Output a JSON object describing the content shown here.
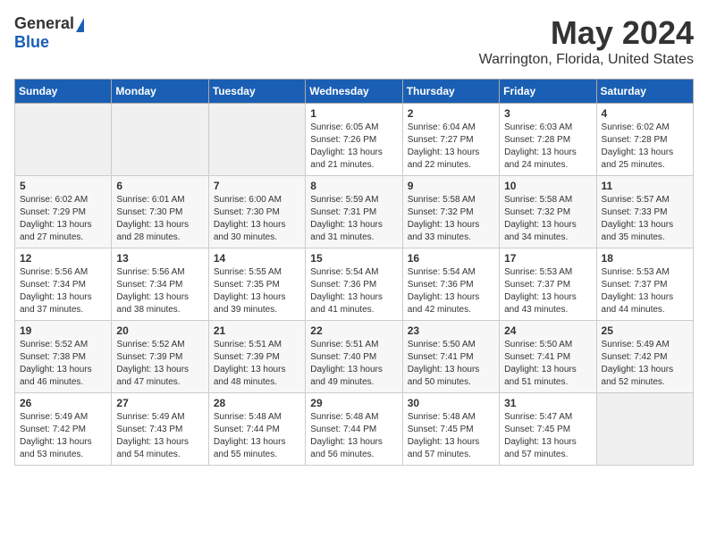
{
  "header": {
    "logo_general": "General",
    "logo_blue": "Blue",
    "month": "May 2024",
    "location": "Warrington, Florida, United States"
  },
  "calendar": {
    "days_of_week": [
      "Sunday",
      "Monday",
      "Tuesday",
      "Wednesday",
      "Thursday",
      "Friday",
      "Saturday"
    ],
    "weeks": [
      [
        {
          "day": "",
          "empty": true
        },
        {
          "day": "",
          "empty": true
        },
        {
          "day": "",
          "empty": true
        },
        {
          "day": "1",
          "sunrise": "6:05 AM",
          "sunset": "7:26 PM",
          "daylight": "13 hours and 21 minutes."
        },
        {
          "day": "2",
          "sunrise": "6:04 AM",
          "sunset": "7:27 PM",
          "daylight": "13 hours and 22 minutes."
        },
        {
          "day": "3",
          "sunrise": "6:03 AM",
          "sunset": "7:28 PM",
          "daylight": "13 hours and 24 minutes."
        },
        {
          "day": "4",
          "sunrise": "6:02 AM",
          "sunset": "7:28 PM",
          "daylight": "13 hours and 25 minutes."
        }
      ],
      [
        {
          "day": "5",
          "sunrise": "6:02 AM",
          "sunset": "7:29 PM",
          "daylight": "13 hours and 27 minutes."
        },
        {
          "day": "6",
          "sunrise": "6:01 AM",
          "sunset": "7:30 PM",
          "daylight": "13 hours and 28 minutes."
        },
        {
          "day": "7",
          "sunrise": "6:00 AM",
          "sunset": "7:30 PM",
          "daylight": "13 hours and 30 minutes."
        },
        {
          "day": "8",
          "sunrise": "5:59 AM",
          "sunset": "7:31 PM",
          "daylight": "13 hours and 31 minutes."
        },
        {
          "day": "9",
          "sunrise": "5:58 AM",
          "sunset": "7:32 PM",
          "daylight": "13 hours and 33 minutes."
        },
        {
          "day": "10",
          "sunrise": "5:58 AM",
          "sunset": "7:32 PM",
          "daylight": "13 hours and 34 minutes."
        },
        {
          "day": "11",
          "sunrise": "5:57 AM",
          "sunset": "7:33 PM",
          "daylight": "13 hours and 35 minutes."
        }
      ],
      [
        {
          "day": "12",
          "sunrise": "5:56 AM",
          "sunset": "7:34 PM",
          "daylight": "13 hours and 37 minutes."
        },
        {
          "day": "13",
          "sunrise": "5:56 AM",
          "sunset": "7:34 PM",
          "daylight": "13 hours and 38 minutes."
        },
        {
          "day": "14",
          "sunrise": "5:55 AM",
          "sunset": "7:35 PM",
          "daylight": "13 hours and 39 minutes."
        },
        {
          "day": "15",
          "sunrise": "5:54 AM",
          "sunset": "7:36 PM",
          "daylight": "13 hours and 41 minutes."
        },
        {
          "day": "16",
          "sunrise": "5:54 AM",
          "sunset": "7:36 PM",
          "daylight": "13 hours and 42 minutes."
        },
        {
          "day": "17",
          "sunrise": "5:53 AM",
          "sunset": "7:37 PM",
          "daylight": "13 hours and 43 minutes."
        },
        {
          "day": "18",
          "sunrise": "5:53 AM",
          "sunset": "7:37 PM",
          "daylight": "13 hours and 44 minutes."
        }
      ],
      [
        {
          "day": "19",
          "sunrise": "5:52 AM",
          "sunset": "7:38 PM",
          "daylight": "13 hours and 46 minutes."
        },
        {
          "day": "20",
          "sunrise": "5:52 AM",
          "sunset": "7:39 PM",
          "daylight": "13 hours and 47 minutes."
        },
        {
          "day": "21",
          "sunrise": "5:51 AM",
          "sunset": "7:39 PM",
          "daylight": "13 hours and 48 minutes."
        },
        {
          "day": "22",
          "sunrise": "5:51 AM",
          "sunset": "7:40 PM",
          "daylight": "13 hours and 49 minutes."
        },
        {
          "day": "23",
          "sunrise": "5:50 AM",
          "sunset": "7:41 PM",
          "daylight": "13 hours and 50 minutes."
        },
        {
          "day": "24",
          "sunrise": "5:50 AM",
          "sunset": "7:41 PM",
          "daylight": "13 hours and 51 minutes."
        },
        {
          "day": "25",
          "sunrise": "5:49 AM",
          "sunset": "7:42 PM",
          "daylight": "13 hours and 52 minutes."
        }
      ],
      [
        {
          "day": "26",
          "sunrise": "5:49 AM",
          "sunset": "7:42 PM",
          "daylight": "13 hours and 53 minutes."
        },
        {
          "day": "27",
          "sunrise": "5:49 AM",
          "sunset": "7:43 PM",
          "daylight": "13 hours and 54 minutes."
        },
        {
          "day": "28",
          "sunrise": "5:48 AM",
          "sunset": "7:44 PM",
          "daylight": "13 hours and 55 minutes."
        },
        {
          "day": "29",
          "sunrise": "5:48 AM",
          "sunset": "7:44 PM",
          "daylight": "13 hours and 56 minutes."
        },
        {
          "day": "30",
          "sunrise": "5:48 AM",
          "sunset": "7:45 PM",
          "daylight": "13 hours and 57 minutes."
        },
        {
          "day": "31",
          "sunrise": "5:47 AM",
          "sunset": "7:45 PM",
          "daylight": "13 hours and 57 minutes."
        },
        {
          "day": "",
          "empty": true
        }
      ]
    ]
  }
}
